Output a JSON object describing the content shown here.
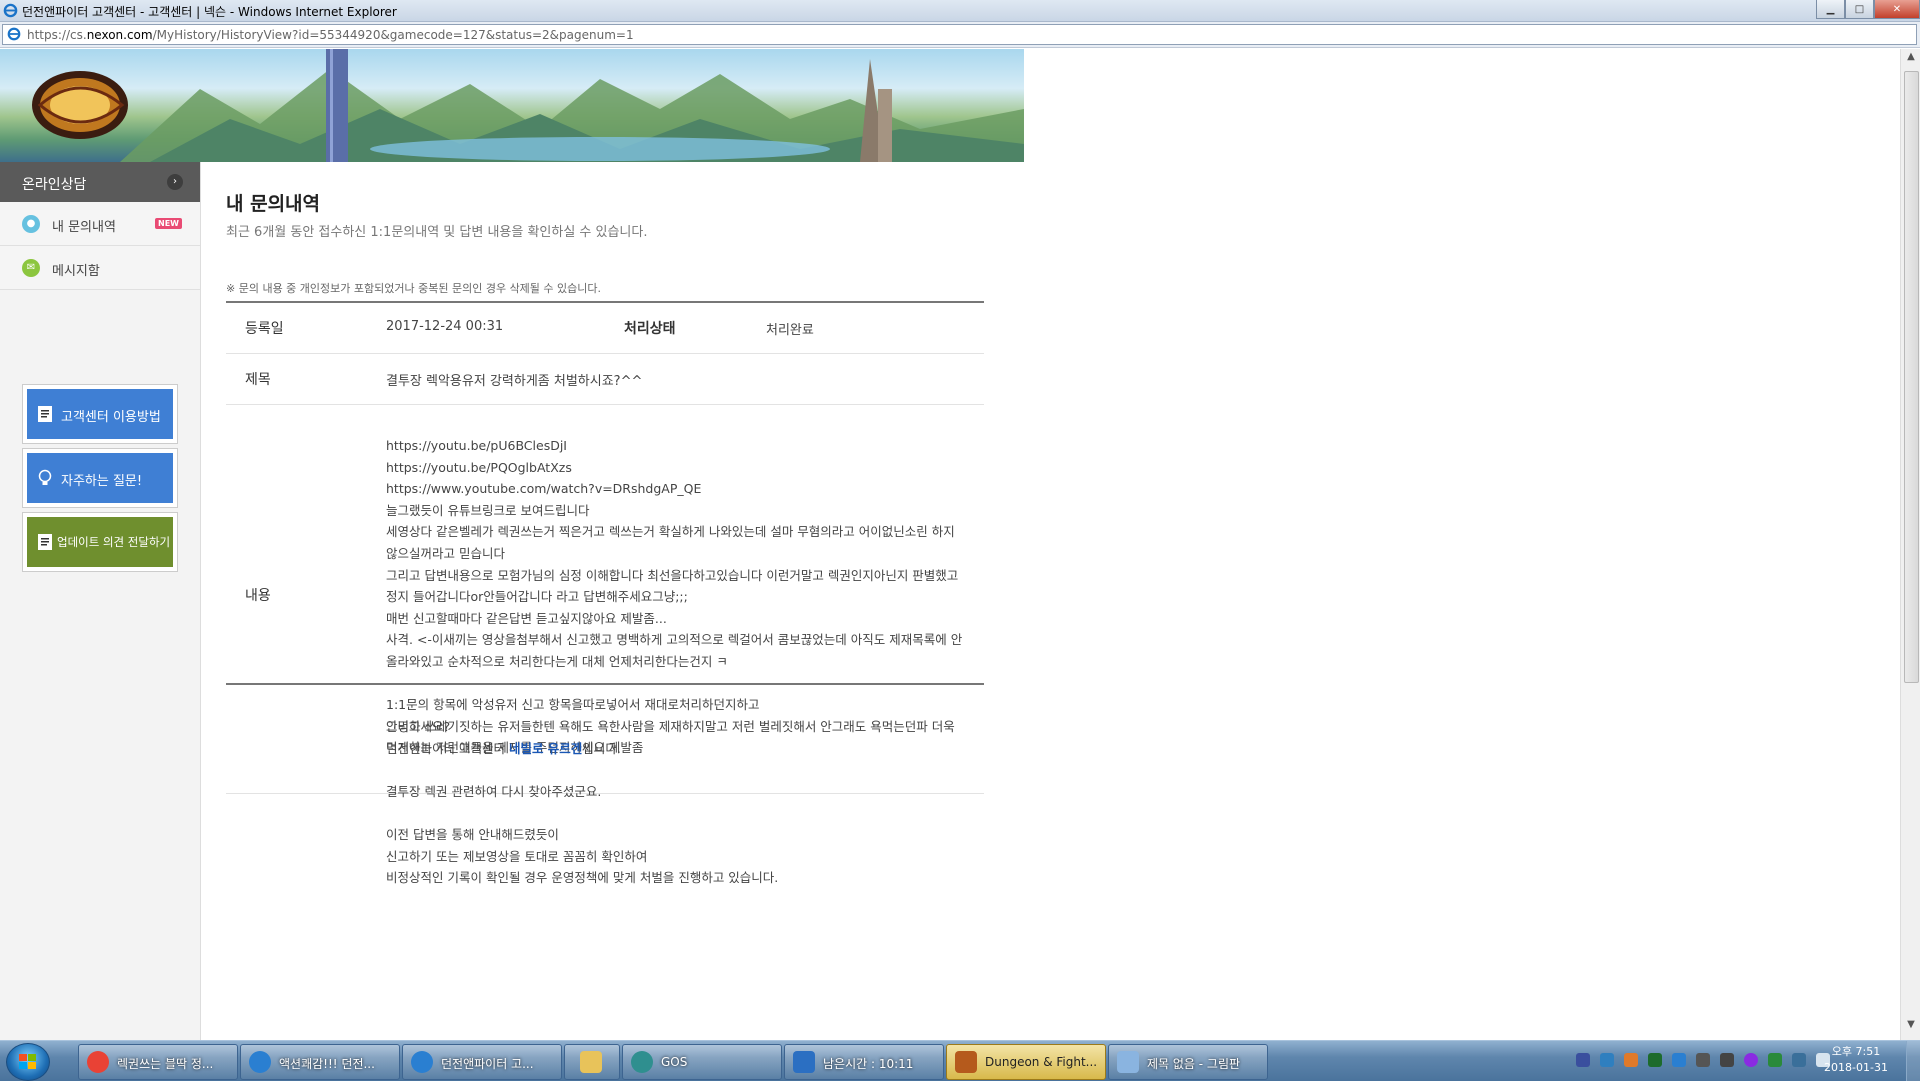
{
  "window": {
    "title": "던전앤파이터 고객센터 - 고객센터 | 넥슨 - Windows Internet Explorer",
    "url_prefix": "https://cs.",
    "url_host": "nexon.com",
    "url_path": "/MyHistory/HistoryView?id=55344920&gamecode=127&status=2&pagenum=1",
    "min_glyph": "▁",
    "max_glyph": "□",
    "close_glyph": "✕"
  },
  "sidebar": {
    "header": "온라인상담",
    "header_arrow": "›",
    "items": [
      {
        "label": "내 문의내역",
        "icon": "chat-bubble-icon",
        "badge": "NEW"
      },
      {
        "label": "메시지함",
        "icon": "envelope-icon"
      }
    ],
    "buttons": [
      {
        "label": "고객센터 이용방법",
        "icon": "document-icon",
        "color": "#3f7fd4"
      },
      {
        "label": "자주하는 질문!",
        "icon": "lightbulb-icon",
        "color": "#3f7fd4"
      },
      {
        "label": "업데이트 의견 전달하기",
        "icon": "document-icon",
        "color": "#6f8f2e"
      }
    ]
  },
  "main": {
    "title": "내 문의내역",
    "subtitle": "최근 6개월 동안 접수하신 1:1문의내역 및 답변 내용을 확인하실 수 있습니다.",
    "notice": "※ 문의 내용 중 개인정보가 포함되었거나 중복된 문의인 경우 삭제될 수 있습니다.",
    "labels": {
      "date": "등록일",
      "status": "처리상태",
      "subject": "제목",
      "body": "내용"
    },
    "date_value": "2017-12-24 00:31",
    "status_value": "처리완료",
    "subject_value": "결투장 렉악용유저 강력하게좀 처벌하시죠?^^",
    "body_lines": [
      "https://youtu.be/pU6BClesDjI",
      "https://youtu.be/PQOglbAtXzs",
      "https://www.youtube.com/watch?v=DRshdgAP_QE",
      "늘그랬듯이 유튜브링크로 보여드립니다",
      "세영상다 같은벨레가 렉권쓰는거 찍은거고 렉쓰는거 확실하게 나와있는데 설마 무혐의라고 어이없닌소린 하지",
      "않으실꺼라고 믿습니다",
      "그리고 답변내용으로 모험가님의 심정 이해합니다 최선을다하고있습니다 이런거말고 렉권인지아닌지 판별했고",
      "정지 들어갑니다or안들어갑니다 라고 답변해주세요그냥;;;",
      "매번 신고할때마다 같은답변 듣고싶지않아요 제발좀...",
      "사격. <-이새끼는 영상을첨부해서 신고했고 명백하게 고의적으로 렉걸어서 콤보끊었는데 아직도 제재목록에 안",
      "올라와있고 순차적으로 처리한다는게 대체 언제처리한다는건지 ㅋ",
      "",
      "1:1문의 항목에 악성유저 신고 항목을따로넣어서 재대로처리하던지하고",
      "그리고 쓰레기짓하는 유저들한텐 욕해도 욕한사람을 제재하지말고 저런 벌레짓해서 안그래도 욕먹는던파 더욱",
      "먹게하는 저런애들을 제재를 주던지하세요 제발좀"
    ],
    "answer": {
      "greeting": "안녕하세요?",
      "intro_prefix": "던전앤파이터 고객센터 ",
      "intro_name": "네빌로 유르겐",
      "intro_suffix": "입니다.",
      "lines": [
        "결투장 렉권 관련하여 다시 찾아주셨군요.",
        "",
        "이전 답변을 통해 안내해드렸듯이",
        "신고하기 또는 제보영상을 토대로 꼼꼼히 확인하여",
        "비정상적인 기록이 확인될 경우 운영정책에 맞게 처벌을 진행하고 있습니다."
      ]
    }
  },
  "taskbar": {
    "tasks": [
      {
        "label": "렉권쓰는 블딱 정...",
        "icon": "chrome-icon",
        "color": "#e94235"
      },
      {
        "label": "액션쾌감!!! 던전...",
        "icon": "ie-icon",
        "color": "#2a7fd1"
      },
      {
        "label": "던전앤파이터 고...",
        "icon": "ie-icon",
        "color": "#2a7fd1"
      },
      {
        "label": "",
        "icon": "folder-icon",
        "color": "#e8c35a"
      },
      {
        "label": "GOS",
        "icon": "gos-icon",
        "color": "#2f8f8f"
      },
      {
        "label": "남은시간 : 10:11",
        "icon": "mult-icon",
        "color": "#2b6fc2"
      },
      {
        "label": "Dungeon & Fight...",
        "icon": "dnf-icon",
        "color": "#b55a1c",
        "active": true
      },
      {
        "label": "제목 없음 - 그림판",
        "icon": "paint-icon",
        "color": "#8ab4e0"
      }
    ],
    "clock_time": "오후 7:51",
    "clock_date": "2018-01-31"
  }
}
